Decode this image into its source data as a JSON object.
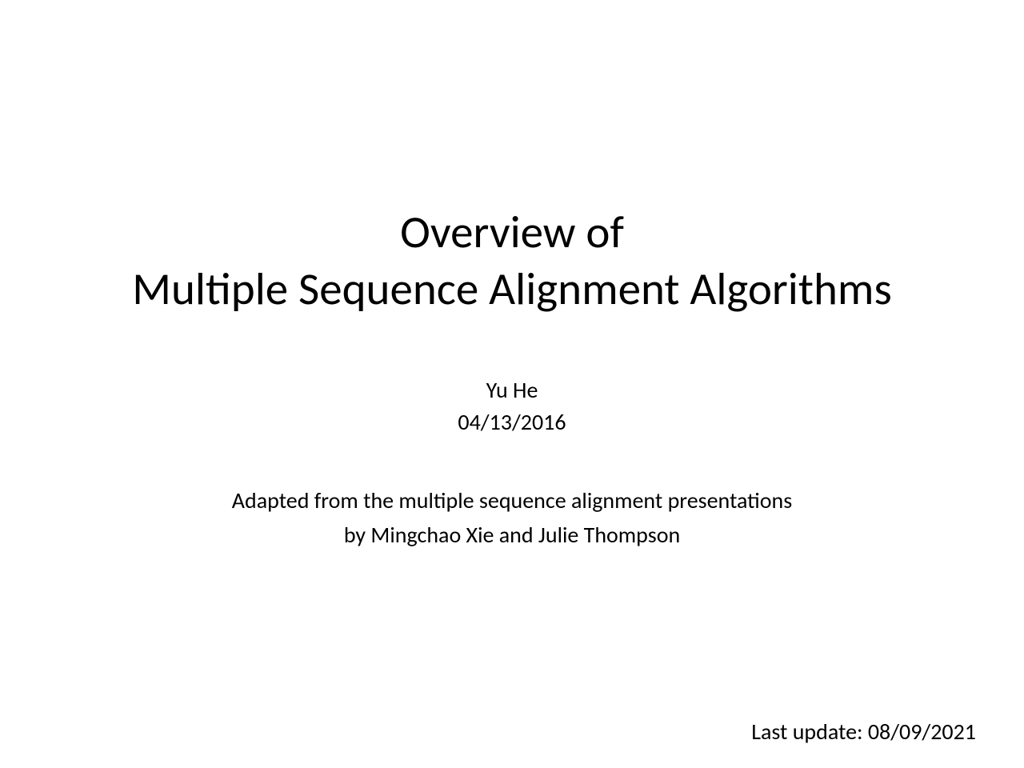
{
  "title_line1": "Overview of",
  "title_line2": "Multiple Sequence Alignment Algorithms",
  "author": "Yu He",
  "date": "04/13/2016",
  "adapted_line1": "Adapted from the multiple sequence alignment presentations",
  "adapted_line2": "by Mingchao Xie and Julie Thompson",
  "last_update": "Last update: 08/09/2021"
}
